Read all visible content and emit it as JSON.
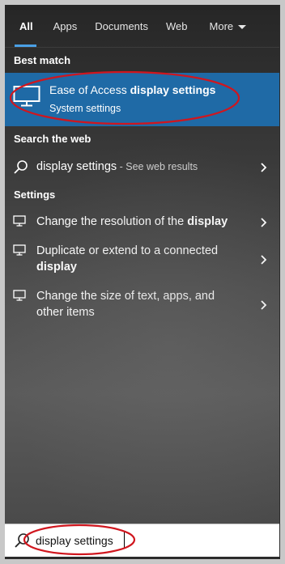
{
  "tabs": [
    {
      "label": "All",
      "active": true
    },
    {
      "label": "Apps"
    },
    {
      "label": "Documents"
    },
    {
      "label": "Web"
    },
    {
      "label": "More"
    }
  ],
  "best_match": {
    "section_label": "Best match",
    "title_prefix": "Ease of Access ",
    "title_bold": "display settings",
    "subtitle": "System settings",
    "icon": "monitor-icon"
  },
  "web": {
    "section_label": "Search the web",
    "query": "display settings",
    "suffix": " - See web results",
    "icon": "search-icon"
  },
  "settings": {
    "section_label": "Settings",
    "items": [
      {
        "text_a": "Change the resolution of the ",
        "bold": "display",
        "text_b": ""
      },
      {
        "text_a": "Duplicate or extend to a connected",
        "bold": "display",
        "text_b": ""
      },
      {
        "text_a": "Change the size of text, apps, and",
        "text_b": "other items"
      }
    ]
  },
  "search": {
    "value": "display settings",
    "icon": "search-icon"
  },
  "colors": {
    "accent": "#4aa0e6",
    "highlight": "#1f6aa6",
    "annotation": "#d0161e"
  }
}
